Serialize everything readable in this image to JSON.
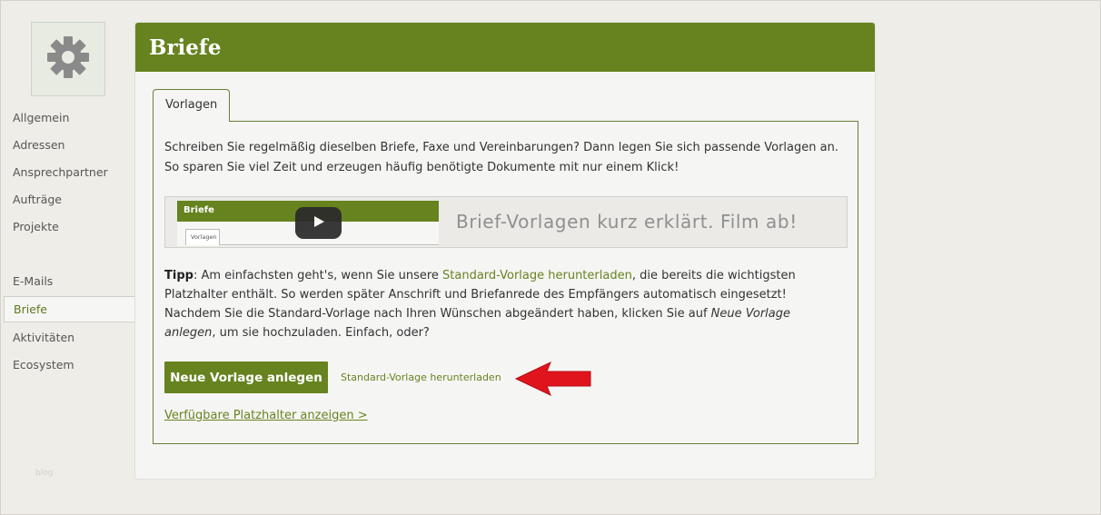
{
  "sidebar": {
    "items": [
      {
        "label": "Allgemein"
      },
      {
        "label": "Adressen"
      },
      {
        "label": "Ansprechpartner"
      },
      {
        "label": "Aufträge"
      },
      {
        "label": "Projekte"
      },
      {
        "label": "E-Mails"
      },
      {
        "label": "Briefe"
      },
      {
        "label": "Aktivitäten"
      },
      {
        "label": "Ecosystem"
      }
    ],
    "active_item": "Briefe",
    "footer_text": "blog"
  },
  "main": {
    "title": "Briefe",
    "tabs": [
      {
        "label": "Vorlagen"
      }
    ],
    "intro_line1": "Schreiben Sie regelmäßig dieselben Briefe, Faxe und Vereinbarungen? Dann legen Sie sich passende Vorlagen an.",
    "intro_line2": "So sparen Sie viel Zeit und erzeugen häufig benötigte Dokumente mit nur einem Klick!",
    "video": {
      "thumb_title": "Briefe",
      "thumb_tab": "Vorlagen",
      "caption": "Brief-Vorlagen kurz erklärt. Film ab!"
    },
    "tip": {
      "label": "Tipp",
      "text_1": ": Am einfachsten geht's, wenn Sie unsere ",
      "link": "Standard-Vorlage herunterladen",
      "text_2": ", die bereits die wichtigsten Platzhalter enthält. So werden später Anschrift und Briefanrede des Empfängers automatisch eingesetzt! Nachdem Sie die Standard-Vorlage nach Ihren Wünschen abgeändert haben, klicken Sie auf ",
      "emphasis": "Neue Vorlage anlegen",
      "text_3": ", um sie hochzuladen. Einfach, oder?"
    },
    "primary_button": "Neue Vorlage anlegen",
    "download_link": "Standard-Vorlage herunterladen",
    "placeholder_link": "Verfügbare Platzhalter anzeigen >"
  },
  "colors": {
    "brand_green": "#66831f",
    "background": "#efede8",
    "panel": "#f5f5f4",
    "annotation_arrow": "#e0141c"
  }
}
